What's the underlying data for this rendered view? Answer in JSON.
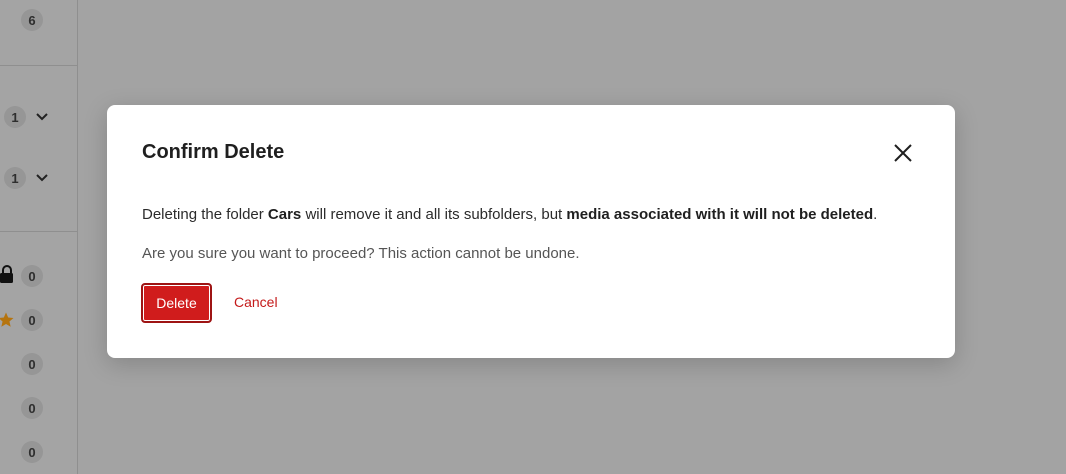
{
  "sidebar": {
    "counts": [
      "6",
      "1",
      "1",
      "0",
      "0",
      "0",
      "0",
      "0"
    ]
  },
  "modal": {
    "title": "Confirm Delete",
    "message_prefix": "Deleting the folder ",
    "folder_name": "Cars",
    "message_middle": " will remove it and all its subfolders, but ",
    "message_bold": "media associated with it will not be deleted",
    "message_suffix": ".",
    "confirm_text": "Are you sure you want to proceed? This action cannot be undone.",
    "delete_label": "Delete",
    "cancel_label": "Cancel"
  },
  "icons": {
    "close": "close-icon",
    "chevron": "chevron-down-icon",
    "lock": "lock-icon",
    "star": "star-icon"
  },
  "colors": {
    "overlay": "#a3a3a3",
    "danger": "#d01c1c",
    "danger_text": "#c41a1a",
    "star": "#b5740f"
  }
}
